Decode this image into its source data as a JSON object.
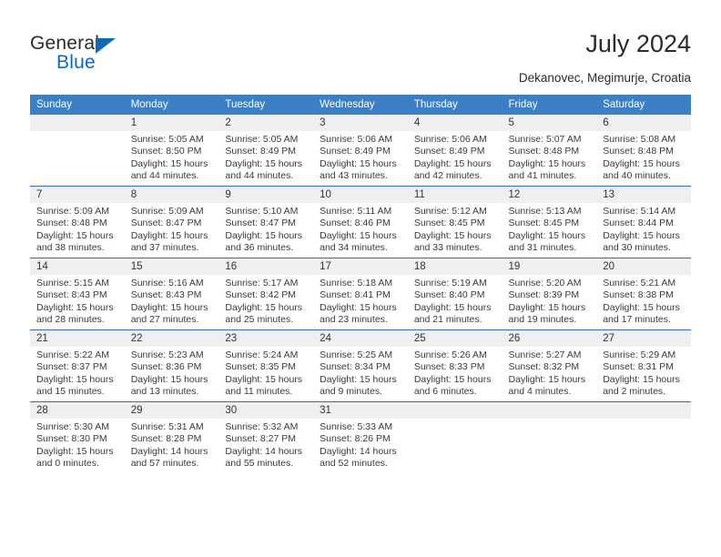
{
  "brand": {
    "name_part1": "General",
    "name_part2": "Blue",
    "triangle_color": "#1268b3"
  },
  "header": {
    "title": "July 2024",
    "subtitle": "Dekanovec, Megimurje, Croatia"
  },
  "theme": {
    "header_blue": "#3b7fc4",
    "row_divider_blue": "#2f6eb5",
    "datenum_band": "#efefef"
  },
  "calendar": {
    "weekday_headers": [
      "Sunday",
      "Monday",
      "Tuesday",
      "Wednesday",
      "Thursday",
      "Friday",
      "Saturday"
    ],
    "weeks": [
      [
        {
          "date": "",
          "lines": []
        },
        {
          "date": "1",
          "lines": [
            "Sunrise: 5:05 AM",
            "Sunset: 8:50 PM",
            "Daylight: 15 hours",
            "and 44 minutes."
          ]
        },
        {
          "date": "2",
          "lines": [
            "Sunrise: 5:05 AM",
            "Sunset: 8:49 PM",
            "Daylight: 15 hours",
            "and 44 minutes."
          ]
        },
        {
          "date": "3",
          "lines": [
            "Sunrise: 5:06 AM",
            "Sunset: 8:49 PM",
            "Daylight: 15 hours",
            "and 43 minutes."
          ]
        },
        {
          "date": "4",
          "lines": [
            "Sunrise: 5:06 AM",
            "Sunset: 8:49 PM",
            "Daylight: 15 hours",
            "and 42 minutes."
          ]
        },
        {
          "date": "5",
          "lines": [
            "Sunrise: 5:07 AM",
            "Sunset: 8:48 PM",
            "Daylight: 15 hours",
            "and 41 minutes."
          ]
        },
        {
          "date": "6",
          "lines": [
            "Sunrise: 5:08 AM",
            "Sunset: 8:48 PM",
            "Daylight: 15 hours",
            "and 40 minutes."
          ]
        }
      ],
      [
        {
          "date": "7",
          "lines": [
            "Sunrise: 5:09 AM",
            "Sunset: 8:48 PM",
            "Daylight: 15 hours",
            "and 38 minutes."
          ]
        },
        {
          "date": "8",
          "lines": [
            "Sunrise: 5:09 AM",
            "Sunset: 8:47 PM",
            "Daylight: 15 hours",
            "and 37 minutes."
          ]
        },
        {
          "date": "9",
          "lines": [
            "Sunrise: 5:10 AM",
            "Sunset: 8:47 PM",
            "Daylight: 15 hours",
            "and 36 minutes."
          ]
        },
        {
          "date": "10",
          "lines": [
            "Sunrise: 5:11 AM",
            "Sunset: 8:46 PM",
            "Daylight: 15 hours",
            "and 34 minutes."
          ]
        },
        {
          "date": "11",
          "lines": [
            "Sunrise: 5:12 AM",
            "Sunset: 8:45 PM",
            "Daylight: 15 hours",
            "and 33 minutes."
          ]
        },
        {
          "date": "12",
          "lines": [
            "Sunrise: 5:13 AM",
            "Sunset: 8:45 PM",
            "Daylight: 15 hours",
            "and 31 minutes."
          ]
        },
        {
          "date": "13",
          "lines": [
            "Sunrise: 5:14 AM",
            "Sunset: 8:44 PM",
            "Daylight: 15 hours",
            "and 30 minutes."
          ]
        }
      ],
      [
        {
          "date": "14",
          "lines": [
            "Sunrise: 5:15 AM",
            "Sunset: 8:43 PM",
            "Daylight: 15 hours",
            "and 28 minutes."
          ]
        },
        {
          "date": "15",
          "lines": [
            "Sunrise: 5:16 AM",
            "Sunset: 8:43 PM",
            "Daylight: 15 hours",
            "and 27 minutes."
          ]
        },
        {
          "date": "16",
          "lines": [
            "Sunrise: 5:17 AM",
            "Sunset: 8:42 PM",
            "Daylight: 15 hours",
            "and 25 minutes."
          ]
        },
        {
          "date": "17",
          "lines": [
            "Sunrise: 5:18 AM",
            "Sunset: 8:41 PM",
            "Daylight: 15 hours",
            "and 23 minutes."
          ]
        },
        {
          "date": "18",
          "lines": [
            "Sunrise: 5:19 AM",
            "Sunset: 8:40 PM",
            "Daylight: 15 hours",
            "and 21 minutes."
          ]
        },
        {
          "date": "19",
          "lines": [
            "Sunrise: 5:20 AM",
            "Sunset: 8:39 PM",
            "Daylight: 15 hours",
            "and 19 minutes."
          ]
        },
        {
          "date": "20",
          "lines": [
            "Sunrise: 5:21 AM",
            "Sunset: 8:38 PM",
            "Daylight: 15 hours",
            "and 17 minutes."
          ]
        }
      ],
      [
        {
          "date": "21",
          "lines": [
            "Sunrise: 5:22 AM",
            "Sunset: 8:37 PM",
            "Daylight: 15 hours",
            "and 15 minutes."
          ]
        },
        {
          "date": "22",
          "lines": [
            "Sunrise: 5:23 AM",
            "Sunset: 8:36 PM",
            "Daylight: 15 hours",
            "and 13 minutes."
          ]
        },
        {
          "date": "23",
          "lines": [
            "Sunrise: 5:24 AM",
            "Sunset: 8:35 PM",
            "Daylight: 15 hours",
            "and 11 minutes."
          ]
        },
        {
          "date": "24",
          "lines": [
            "Sunrise: 5:25 AM",
            "Sunset: 8:34 PM",
            "Daylight: 15 hours",
            "and 9 minutes."
          ]
        },
        {
          "date": "25",
          "lines": [
            "Sunrise: 5:26 AM",
            "Sunset: 8:33 PM",
            "Daylight: 15 hours",
            "and 6 minutes."
          ]
        },
        {
          "date": "26",
          "lines": [
            "Sunrise: 5:27 AM",
            "Sunset: 8:32 PM",
            "Daylight: 15 hours",
            "and 4 minutes."
          ]
        },
        {
          "date": "27",
          "lines": [
            "Sunrise: 5:29 AM",
            "Sunset: 8:31 PM",
            "Daylight: 15 hours",
            "and 2 minutes."
          ]
        }
      ],
      [
        {
          "date": "28",
          "lines": [
            "Sunrise: 5:30 AM",
            "Sunset: 8:30 PM",
            "Daylight: 15 hours",
            "and 0 minutes."
          ]
        },
        {
          "date": "29",
          "lines": [
            "Sunrise: 5:31 AM",
            "Sunset: 8:28 PM",
            "Daylight: 14 hours",
            "and 57 minutes."
          ]
        },
        {
          "date": "30",
          "lines": [
            "Sunrise: 5:32 AM",
            "Sunset: 8:27 PM",
            "Daylight: 14 hours",
            "and 55 minutes."
          ]
        },
        {
          "date": "31",
          "lines": [
            "Sunrise: 5:33 AM",
            "Sunset: 8:26 PM",
            "Daylight: 14 hours",
            "and 52 minutes."
          ]
        },
        {
          "date": "",
          "lines": []
        },
        {
          "date": "",
          "lines": []
        },
        {
          "date": "",
          "lines": []
        }
      ]
    ]
  }
}
